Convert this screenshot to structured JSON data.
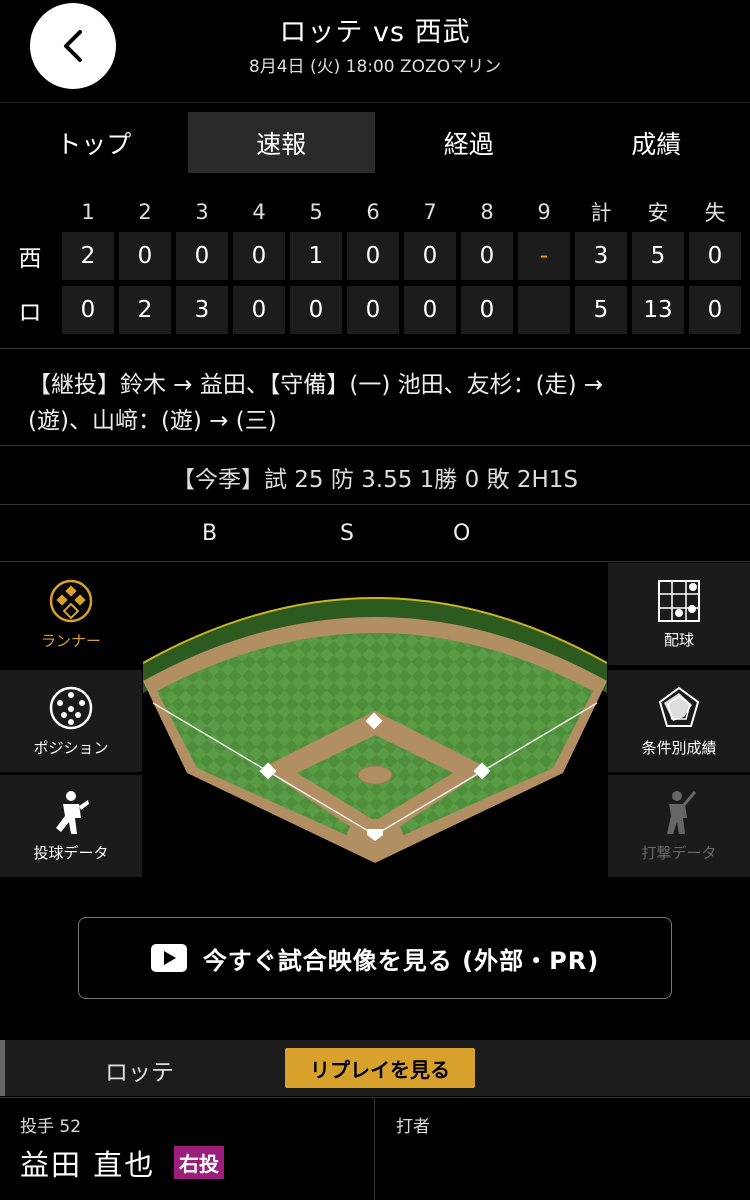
{
  "header": {
    "title": "ロッテ vs 西武",
    "subtitle": "8月4日 (火) 18:00 ZOZOマリン"
  },
  "tabs": [
    {
      "label": "トップ"
    },
    {
      "label": "速報"
    },
    {
      "label": "経過"
    },
    {
      "label": "成績"
    }
  ],
  "scoreboard": {
    "columns": [
      "1",
      "2",
      "3",
      "4",
      "5",
      "6",
      "7",
      "8",
      "9",
      "計",
      "安",
      "失"
    ],
    "rows": [
      {
        "team": "西",
        "cells": [
          "2",
          "0",
          "0",
          "0",
          "1",
          "0",
          "0",
          "0",
          "-",
          "3",
          "5",
          "0"
        ]
      },
      {
        "team": "ロ",
        "cells": [
          "0",
          "2",
          "3",
          "0",
          "0",
          "0",
          "0",
          "0",
          "",
          "5",
          "13",
          "0"
        ]
      }
    ]
  },
  "notes": {
    "line1": "【継投】鈴木 → 益田、【守備】(一) 池田、友杉：(走) →",
    "line2": "(遊)、山﨑：(遊) → (三)"
  },
  "season_stats": "【今季】試 25 防 3.55 1勝 0 敗 2H1S",
  "bso": {
    "b": "B",
    "s": "S",
    "o": "O"
  },
  "side_menu": {
    "runner": "ランナー",
    "position": "ポジション",
    "pitching_data": "投球データ",
    "pitch_chart": "配球",
    "conditional_stats": "条件別成績",
    "batting_data": "打撃データ"
  },
  "video_button": "今すぐ試合映像を見る (外部・PR)",
  "bottom_bar": {
    "team": "ロッテ",
    "replay": "リプレイを見る"
  },
  "pitcher": {
    "role": "投手 52",
    "name": "益田 直也",
    "hand": "右投"
  },
  "batter": {
    "role": "打者"
  },
  "colors": {
    "accent": "#d8a12c",
    "hand_badge": "#9b1f7a",
    "dash": "#f39c12"
  }
}
